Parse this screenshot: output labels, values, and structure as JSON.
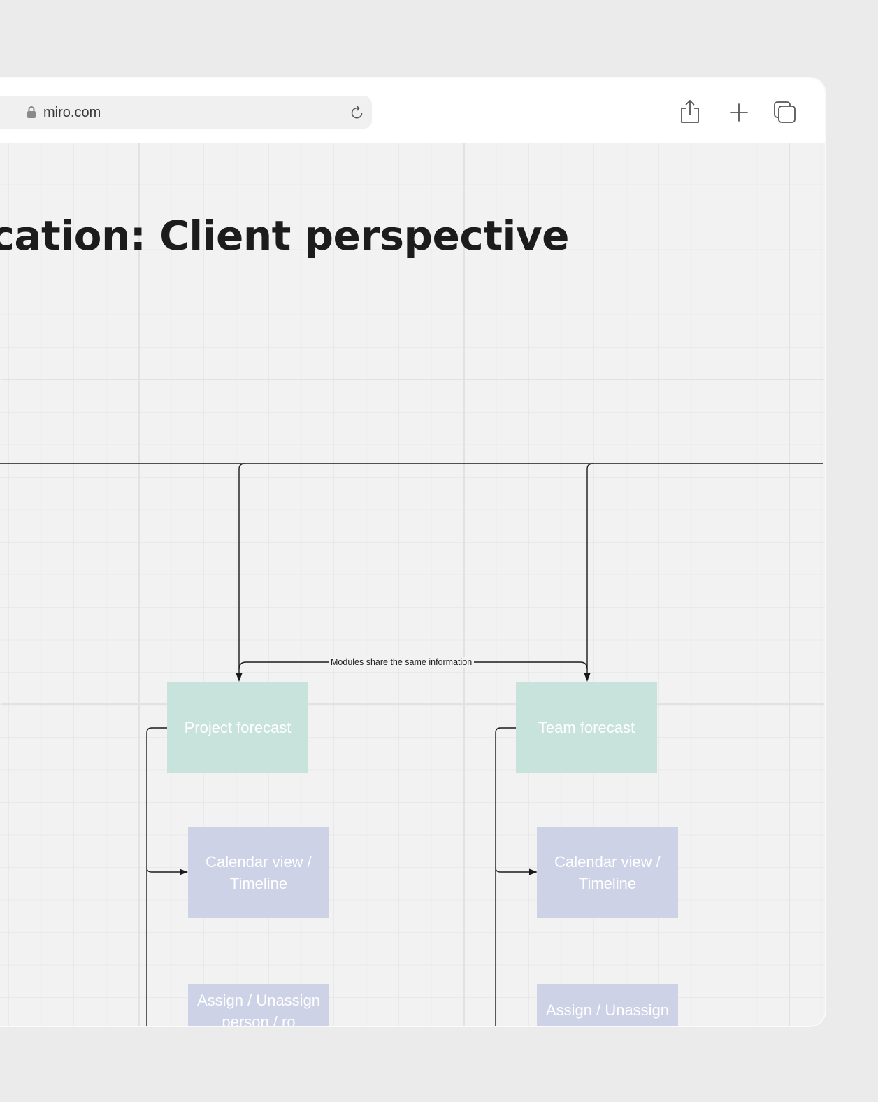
{
  "browser": {
    "url": "miro.com",
    "icons": {
      "lock": "lock-icon",
      "reload": "reload-icon",
      "share": "share-icon",
      "new_tab": "plus-icon",
      "tabs": "tabs-icon"
    }
  },
  "board": {
    "title": "plication: Client perspective",
    "edge_label": "Modules share the same information",
    "nodes": {
      "project_forecast": "Project forecast",
      "team_forecast": "Team forecast",
      "project_calendar": "Calendar view / Timeline",
      "team_calendar": "Calendar view / Timeline",
      "project_assign": "Assign / Unassign person / ro",
      "team_assign": "Assign / Unassign"
    }
  },
  "colors": {
    "forecast_node": "#c8e3dc",
    "detail_node": "#ced2e6",
    "connector": "#1a1a1a",
    "title_text": "#1c1c1c"
  }
}
